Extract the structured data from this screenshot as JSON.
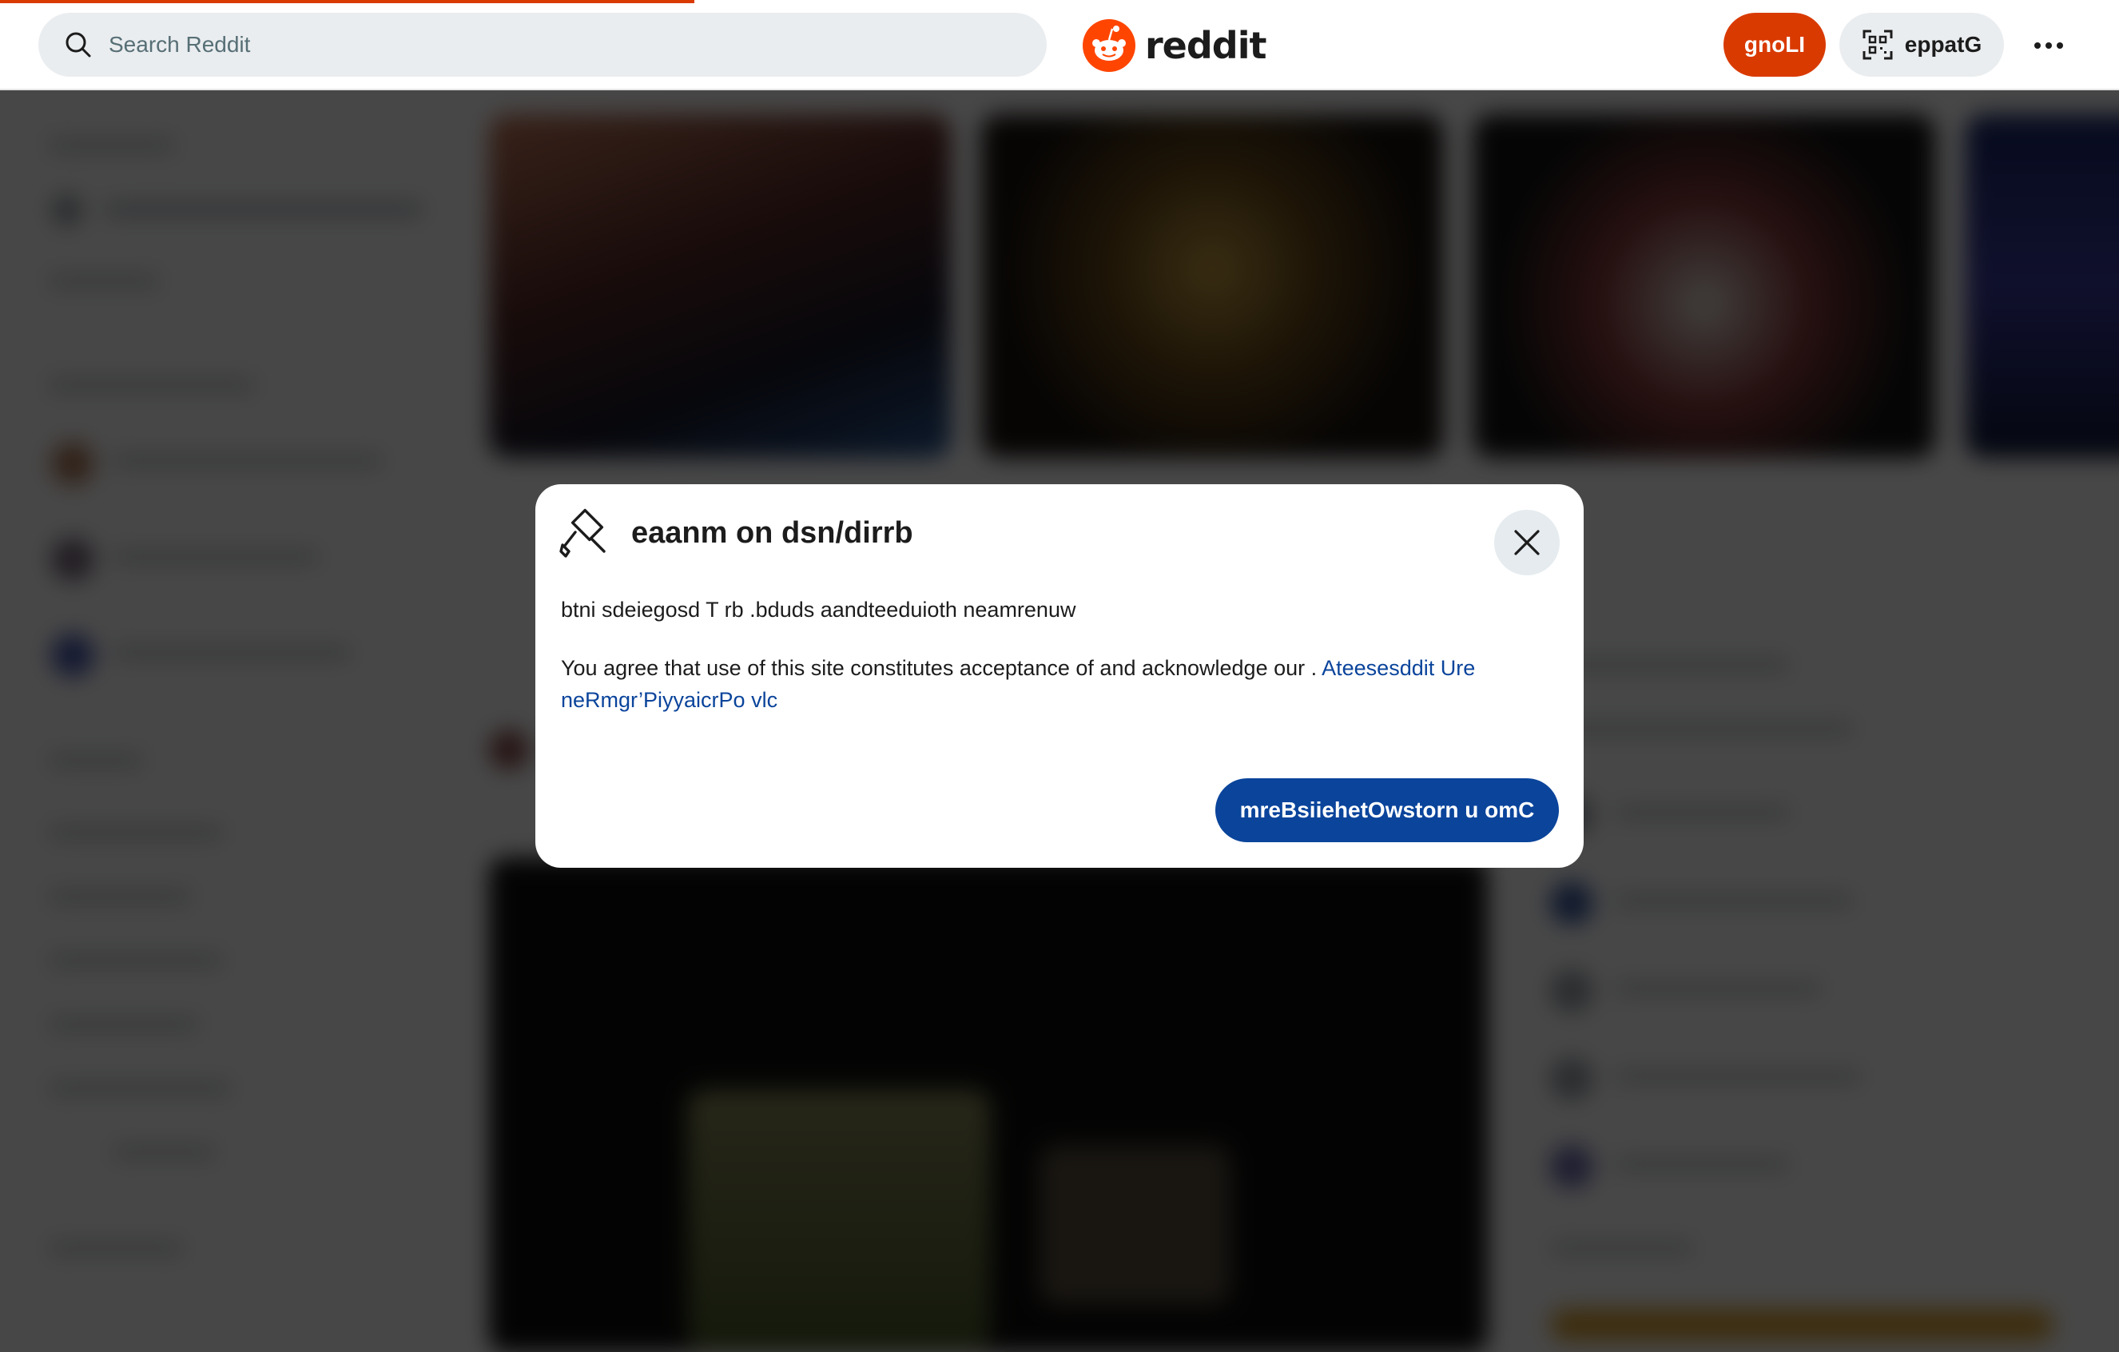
{
  "header": {
    "search_placeholder": "Search Reddit",
    "logo_text": "reddit",
    "login_label": "gnoLI",
    "get_app_label": "eppatG",
    "brand_color": "#d93a00"
  },
  "modal": {
    "title": "eaanm on dsn/dirrb",
    "line1": "btni sdeiegosd T rb .bduds aandteeduioth neamrenuw",
    "line2_prefix": "You agree that use of this site constitutes acceptance of and acknowledge our . ",
    "line2_link": "Ateesesddit Ure neRmgr’PiyyaicrPo vlc",
    "continue_label": "mreBsiiehetOwstorn u omC",
    "continue_color": "#0a449b"
  }
}
